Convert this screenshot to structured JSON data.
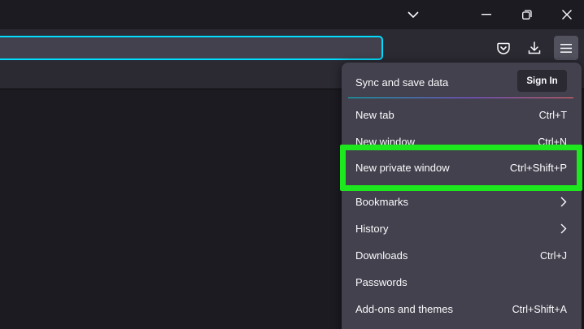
{
  "menu": {
    "sync": {
      "label": "Sync and save data",
      "sign_in": "Sign In"
    },
    "items": [
      {
        "label": "New tab",
        "shortcut": "Ctrl+T"
      },
      {
        "label": "New window",
        "shortcut": "Ctrl+N"
      },
      {
        "label": "New private window",
        "shortcut": "Ctrl+Shift+P"
      },
      {
        "label": "Bookmarks",
        "shortcut": ""
      },
      {
        "label": "History",
        "shortcut": ""
      },
      {
        "label": "Downloads",
        "shortcut": "Ctrl+J"
      },
      {
        "label": "Passwords",
        "shortcut": ""
      },
      {
        "label": "Add-ons and themes",
        "shortcut": "Ctrl+Shift+A"
      }
    ]
  },
  "toolbar_icons": [
    "pocket-icon",
    "download-icon",
    "hamburger-menu-icon"
  ],
  "window_controls": [
    "chevron-down-icon",
    "minimize-icon",
    "restore-icon",
    "close-icon"
  ],
  "colors": {
    "highlight": "#1de81d",
    "urlbar_focus": "#00ddff",
    "menu_bg": "#42414d"
  }
}
